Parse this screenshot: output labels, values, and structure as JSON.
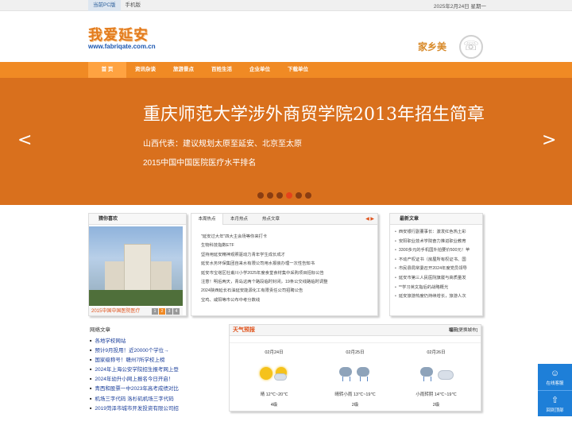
{
  "topbar": {
    "pc_label": "当前PC版",
    "mobile_label": "手机版",
    "date": "2025年2月24日 星期一"
  },
  "header": {
    "logo_text": "我爱延安",
    "logo_url": "www.fabriqate.com.cn",
    "brand_text": "家乡美"
  },
  "nav": {
    "items": [
      "首 页",
      "资讯杂谈",
      "旅游景点",
      "百姓生活",
      "企业单位",
      "下载单位"
    ]
  },
  "banner": {
    "title": "重庆师范大学涉外商贸学院2013年招生简章",
    "line1": "山西代表：建议规划太原至延安、北京至太原",
    "line2": "2015中国中国医院医疗水平排名",
    "prev": "<",
    "next": ">",
    "dot_count": 6,
    "active_dot": 3
  },
  "photo_panel": {
    "title": "猜你喜欢",
    "caption": "2015中国中国医院医疗",
    "pages": [
      "1",
      "2",
      "3",
      "4"
    ],
    "active_page": 1
  },
  "news_panel": {
    "tabs": [
      "本周热点",
      "本月热点",
      "热点文章"
    ],
    "arrows": "◀ ▶",
    "items": [
      "\"延安过大年\"四大主会场等你来打卡",
      "生物科技指数ETF",
      "坚持用延安精神观照驱动力青年学生成长成才",
      "延安水务环保集团自来水有限公司用水报装办理一次性告知书",
      "延安市宝塔区杜甫川小学2025年度食堂食材集中采购项目招标公告",
      "注意！明后两天，青岛这两个路段临时封闭，19条公交线路临时调整",
      "2024陕西延长石油延安能源化工有限责任公司招聘公告",
      "宝鸡、咸阳等市公布中考分数线"
    ]
  },
  "latest_panel": {
    "title": "最新文章",
    "items": [
      "西安银行副董事长：激发红色热土彩",
      "安阳职业技术学院奋力推进职业教育",
      "3300多元的手机国外拍要价500元！苹",
      "不动产权证书（房屋所有权证书、国",
      "市民县局常委召开2024年度党员领导",
      "延安市第三人民医院旗屡与高质量发",
      "**学习英文指后的战略概光",
      "延安旅游热度仍持续增长，旅游人次"
    ]
  },
  "links": {
    "title": "网络文章",
    "items": [
      "各地学校网站",
      "预计9月投用！近20000个学位→",
      "国家级称号！赣州7所学校上榜",
      "2024年上海公安学院招生报考网上登",
      "2024年幼升小网上报名今日开启！",
      "青西和股票一中2023年高考成绩对比",
      "机场三字代码 洛杉矶机场三字代码",
      "2019菏泽市城市开发投资有限公司招"
    ]
  },
  "weather": {
    "title": "天气预报",
    "city": "福田",
    "switch_label": "[更换城市]",
    "days": [
      {
        "date": "02月24日",
        "desc": "晴 12℃~20℃",
        "wind": "4级",
        "icon": "sunny-icon"
      },
      {
        "date": "02月25日",
        "desc": "晴转小雨 13℃~19℃",
        "wind": "2级",
        "icon": "rain-icon"
      },
      {
        "date": "02月26日",
        "desc": "小雨转阴 14℃~19℃",
        "wind": "2级",
        "icon": "cloudy-icon"
      }
    ]
  },
  "float_bar": {
    "consult_label": "在线客服",
    "top_label": "回到顶部"
  }
}
